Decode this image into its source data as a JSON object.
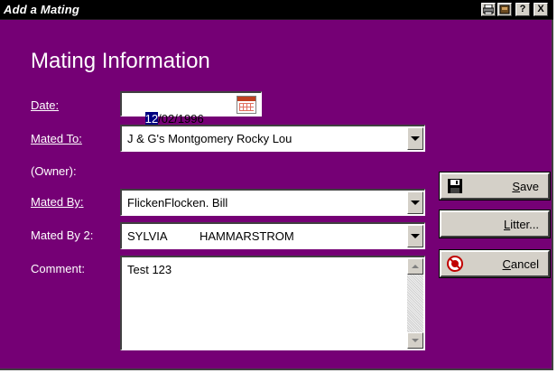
{
  "window": {
    "title": "Add a Mating",
    "titlebar_buttons": [
      "print-icon",
      "tools-icon",
      "?",
      "X"
    ]
  },
  "form": {
    "heading": "Mating Information",
    "date": {
      "label": "Date:",
      "selected_part": "12",
      "rest": "/02/1996",
      "icon": "calendar-icon"
    },
    "mated_to": {
      "label": "Mated To:",
      "value": "J & G's Montgomery Rocky Lou"
    },
    "owner": {
      "label": "(Owner):"
    },
    "mated_by": {
      "label": "Mated By:",
      "value": "FlickenFlocken. Bill"
    },
    "mated_by_2": {
      "label": "Mated By 2:",
      "value": "SYLVIA          HAMMARSTROM"
    },
    "comment": {
      "label": "Comment:",
      "value": "Test 123"
    }
  },
  "buttons": {
    "save": {
      "key": "S",
      "rest": "ave",
      "icon": "floppy-disk-icon"
    },
    "litter": {
      "key": "L",
      "rest": "itter..."
    },
    "cancel": {
      "key": "C",
      "rest": "ancel",
      "icon": "cancel-icon"
    }
  },
  "colors": {
    "background": "#750075",
    "titlebar": "#000000",
    "button_face": "#d4d0c8",
    "selection": "#000080"
  }
}
